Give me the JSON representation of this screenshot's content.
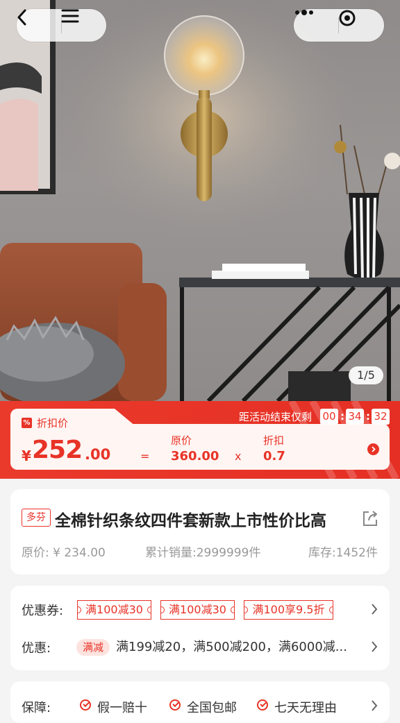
{
  "hero": {
    "pager": "1/5"
  },
  "promo": {
    "label": "折扣价",
    "countdown_label": "距活动结束仅剩",
    "countdown": [
      "00",
      "34",
      "32"
    ],
    "currency": "¥",
    "price_int": "252",
    "price_dec": ".00",
    "equals": "=",
    "times": "x",
    "orig_label": "原价",
    "orig_value": "360.00",
    "disc_label": "折扣",
    "disc_value": "0.7"
  },
  "product": {
    "brand": "多芬",
    "title": "全棉针织条纹四件套新款上市性价比高",
    "orig_price": "原价: ¥ 234.00",
    "sales": "累计销量:2999999件",
    "stock": "库存:1452件"
  },
  "offers": {
    "coupon_label": "优惠券:",
    "coupons": [
      "满100减30",
      "满100减30",
      "满100享9.5折"
    ],
    "promo_label": "优惠:",
    "promo_badge": "满减",
    "promo_text": "满199减20，满500减200，满6000减..."
  },
  "guarantee": {
    "label": "保障:",
    "items": [
      "假一赔十",
      "全国包邮",
      "七天无理由"
    ]
  },
  "colors": {
    "accent": "#e83327",
    "accent_light": "#fde3df"
  }
}
